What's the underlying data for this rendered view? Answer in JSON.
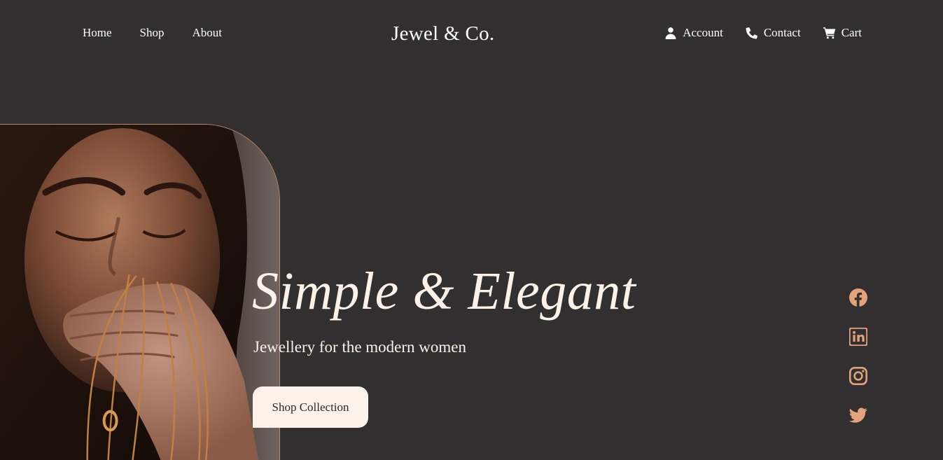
{
  "header": {
    "nav_left": [
      {
        "label": "Home"
      },
      {
        "label": "Shop"
      },
      {
        "label": "About"
      }
    ],
    "logo": "Jewel & Co.",
    "nav_right": [
      {
        "label": "Account",
        "icon": "user-icon"
      },
      {
        "label": "Contact",
        "icon": "phone-icon"
      },
      {
        "label": "Cart",
        "icon": "cart-icon"
      }
    ]
  },
  "hero": {
    "title": "Simple & Elegant",
    "subtitle": "Jewellery for the modern women",
    "cta_label": "Shop Collection",
    "image": "woman-with-gold-chains-photo"
  },
  "social": [
    {
      "name": "facebook-icon"
    },
    {
      "name": "linkedin-icon"
    },
    {
      "name": "instagram-icon"
    },
    {
      "name": "twitter-icon"
    }
  ],
  "colors": {
    "background": "#312f30",
    "cream": "#fdf2ea",
    "accent": "#e3a27a",
    "text": "#ffffff"
  }
}
